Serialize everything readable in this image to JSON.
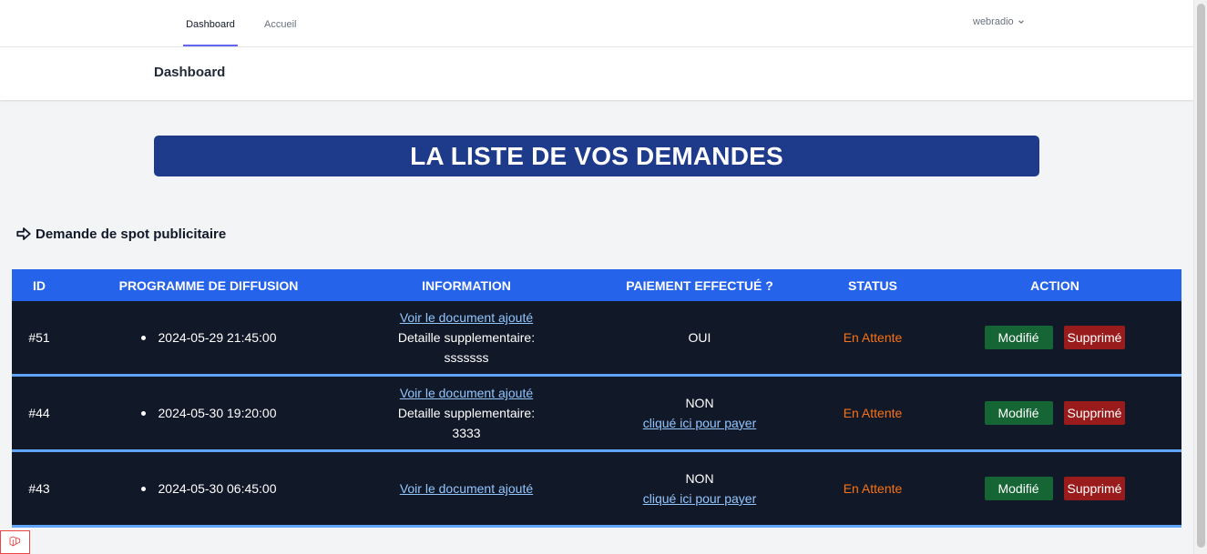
{
  "nav": {
    "links": [
      "Dashboard",
      "Accueil"
    ],
    "user": "webradio"
  },
  "header": {
    "title": "Dashboard"
  },
  "banner": {
    "title": "LA LISTE DE VOS DEMANDES"
  },
  "section": {
    "title": "Demande de spot publicitaire"
  },
  "table": {
    "headers": [
      "ID",
      "PROGRAMME DE DIFFUSION",
      "INFORMATION",
      "PAIEMENT EFFECTUÉ ?",
      "STATUS",
      "ACTION"
    ],
    "rows": [
      {
        "id": "#51",
        "programme": "2024-05-29 21:45:00",
        "doc_link": "Voir le document ajouté",
        "detail_label": "Detaille supplementaire:",
        "detail_value": "sssssss",
        "paiement": "OUI",
        "pay_link": "",
        "status": "En Attente",
        "edit": "Modifié",
        "delete": "Supprimé"
      },
      {
        "id": "#44",
        "programme": "2024-05-30 19:20:00",
        "doc_link": "Voir le document ajouté",
        "detail_label": "Detaille supplementaire:",
        "detail_value": "3333",
        "paiement": "NON",
        "pay_link": "cliqué ici pour payer",
        "status": "En Attente",
        "edit": "Modifié",
        "delete": "Supprimé"
      },
      {
        "id": "#43",
        "programme": "2024-05-30 06:45:00",
        "doc_link": "Voir le document ajouté",
        "detail_label": "",
        "detail_value": "",
        "paiement": "NON",
        "pay_link": "cliqué ici pour payer",
        "status": "En Attente",
        "edit": "Modifié",
        "delete": "Supprimé"
      }
    ]
  },
  "colors": {
    "banner": "#1e3a8a",
    "table_header": "#2563eb",
    "row_bg": "#111827",
    "status": "#f97316",
    "edit_button": "#166534",
    "delete_button": "#991b1b"
  }
}
